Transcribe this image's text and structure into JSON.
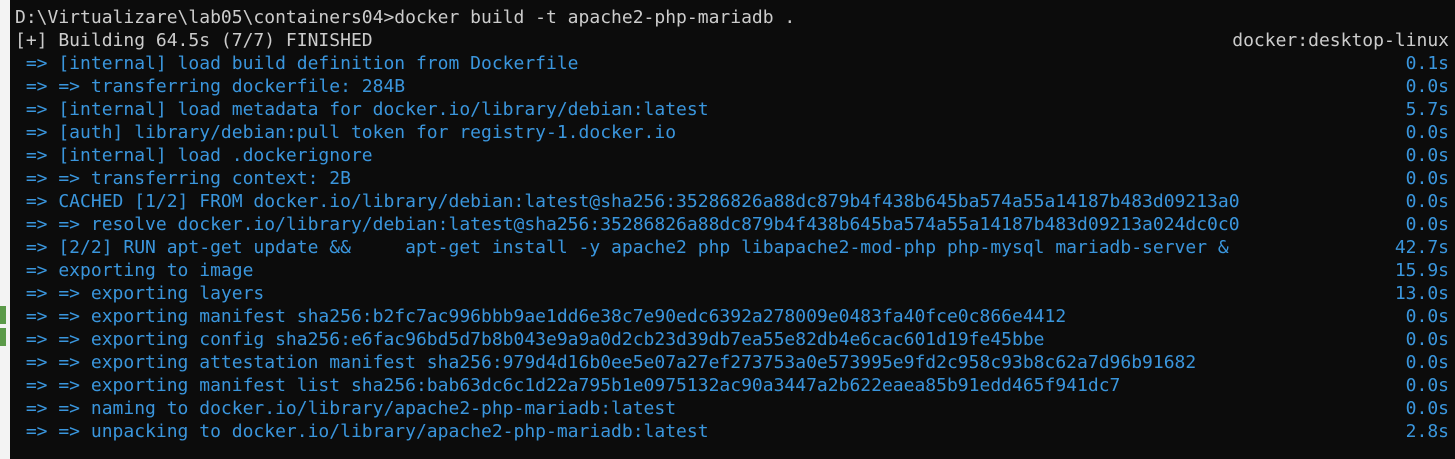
{
  "terminal": {
    "command_line": "D:\\Virtualizare\\lab05\\containers04>docker build -t apache2-php-mariadb .",
    "status": {
      "text": "[+] Building 64.5s (7/7) FINISHED",
      "context": "docker:desktop-linux"
    },
    "steps": [
      {
        "text": " => [internal] load build definition from Dockerfile",
        "time": "0.1s"
      },
      {
        "text": " => => transferring dockerfile: 284B",
        "time": "0.0s"
      },
      {
        "text": " => [internal] load metadata for docker.io/library/debian:latest",
        "time": "5.7s"
      },
      {
        "text": " => [auth] library/debian:pull token for registry-1.docker.io",
        "time": "0.0s"
      },
      {
        "text": " => [internal] load .dockerignore",
        "time": "0.0s"
      },
      {
        "text": " => => transferring context: 2B",
        "time": "0.0s"
      },
      {
        "text": " => CACHED [1/2] FROM docker.io/library/debian:latest@sha256:35286826a88dc879b4f438b645ba574a55a14187b483d09213a0",
        "time": "0.0s"
      },
      {
        "text": " => => resolve docker.io/library/debian:latest@sha256:35286826a88dc879b4f438b645ba574a55a14187b483d09213a024dc0c0",
        "time": "0.0s"
      },
      {
        "text": " => [2/2] RUN apt-get update &&     apt-get install -y apache2 php libapache2-mod-php php-mysql mariadb-server &",
        "time": "42.7s"
      },
      {
        "text": " => exporting to image",
        "time": "15.9s"
      },
      {
        "text": " => => exporting layers",
        "time": "13.0s"
      },
      {
        "text": " => => exporting manifest sha256:b2fc7ac996bbb9ae1dd6e38c7e90edc6392a278009e0483fa40fce0c866e4412",
        "time": "0.0s"
      },
      {
        "text": " => => exporting config sha256:e6fac96bd5d7b8b043e9a9a0d2cb23d39db7ea55e82db4e6cac601d19fe45bbe",
        "time": "0.0s"
      },
      {
        "text": " => => exporting attestation manifest sha256:979d4d16b0ee5e07a27ef273753a0e573995e9fd2c958c93b8c62a7d96b91682",
        "time": "0.0s"
      },
      {
        "text": " => => exporting manifest list sha256:bab63dc6c1d22a795b1e0975132ac90a3447a2b622eaea85b91edd465f941dc7",
        "time": "0.0s"
      },
      {
        "text": " => => naming to docker.io/library/apache2-php-mariadb:latest",
        "time": "0.0s"
      },
      {
        "text": " => => unpacking to docker.io/library/apache2-php-mariadb:latest",
        "time": "2.8s"
      }
    ]
  }
}
